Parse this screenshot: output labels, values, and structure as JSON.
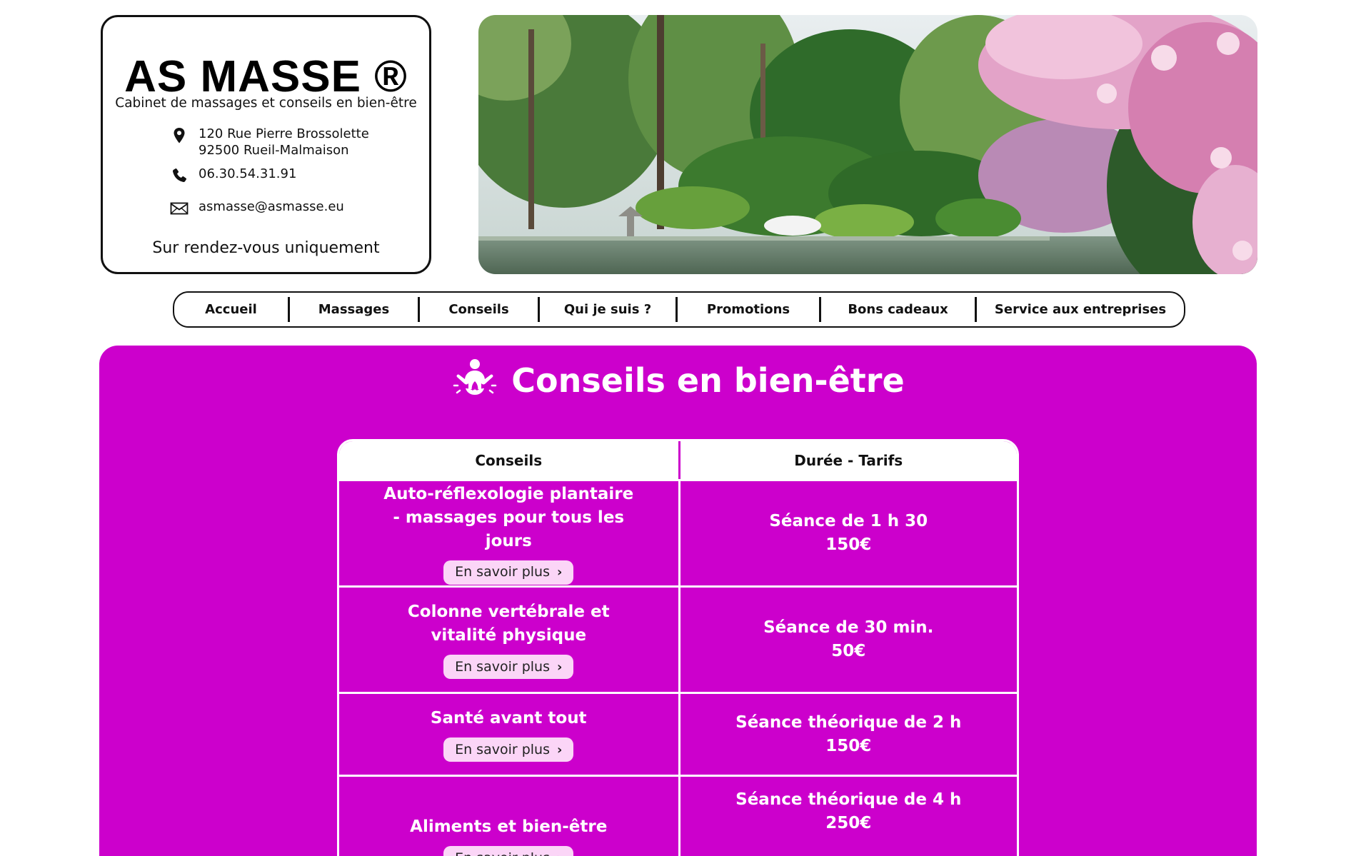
{
  "brand": {
    "name": "AS MASSE ®",
    "tagline": "Cabinet de massages et conseils en bien-être",
    "address_line1": "120 Rue Pierre Brossolette",
    "address_line2": "92500 Rueil-Malmaison",
    "phone": "06.30.54.31.91",
    "email": "asmasse@asmasse.eu",
    "note": "Sur rendez-vous uniquement"
  },
  "nav": {
    "items": [
      {
        "label": "Accueil"
      },
      {
        "label": "Massages"
      },
      {
        "label": "Conseils"
      },
      {
        "label": "Qui je suis ?"
      },
      {
        "label": "Promotions"
      },
      {
        "label": "Bons cadeaux"
      },
      {
        "label": "Service aux entreprises"
      }
    ]
  },
  "section": {
    "title": "Conseils en bien-être",
    "icon": "meditation-lotus-icon"
  },
  "table": {
    "headers": [
      "Conseils",
      "Durée - Tarifs"
    ],
    "rows": [
      {
        "title": "Auto-réflexologie plantaire - massages pour tous les jours",
        "button": "En savoir plus",
        "duration": "Séance de 1 h 30",
        "price": "150€"
      },
      {
        "title": "Colonne vertébrale et vitalité physique",
        "button": "En savoir plus",
        "duration": "Séance de 30 min.",
        "price": "50€"
      },
      {
        "title": "Santé avant tout",
        "button": "En savoir plus",
        "duration": "Séance théorique de 2 h",
        "price": "150€"
      },
      {
        "title": "Aliments et bien-être",
        "button": "En savoir plus",
        "duration": "Séance théorique de 4 h",
        "price": "250€"
      }
    ]
  },
  "colors": {
    "panel": "#cc00cc",
    "button_bg": "#fbd5f7",
    "border": "#111111"
  }
}
